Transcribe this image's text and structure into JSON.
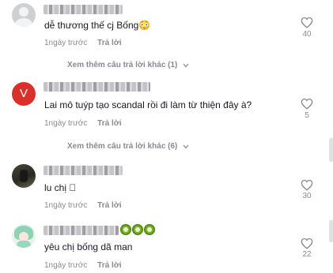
{
  "comments": [
    {
      "text": "dễ thương thế cj Bống😳",
      "time": "1ngày trước",
      "reply": "Trả lời",
      "likes": "40",
      "avatar": "default-avatar",
      "more_replies": "Xem thêm câu trả lời khác (1)"
    },
    {
      "text": "Lai mô tuýp tạo scandal rồi đi làm từ thiện đây à?",
      "time": "1ngày trước",
      "reply": "Trả lời",
      "likes": "5",
      "avatar": "letter-avatar",
      "avatar_letter": "V",
      "more_replies": "Xem thêm câu trả lời khác (6)"
    },
    {
      "text": "lu chị 󾓭",
      "time": "1ngày trước",
      "reply": "Trả lời",
      "likes": "30",
      "avatar": "photo-avatar"
    },
    {
      "text": "yêu chị bống dã man",
      "time": "1ngày trước",
      "reply": "Trả lời",
      "likes": "22",
      "avatar": "anime-avatar"
    }
  ],
  "colors": {
    "text": "#161823",
    "muted": "#8a8b91",
    "avatar_red": "#d9302c"
  },
  "icons": {
    "like": "heart-outline-icon",
    "expand": "chevron-down-icon"
  }
}
